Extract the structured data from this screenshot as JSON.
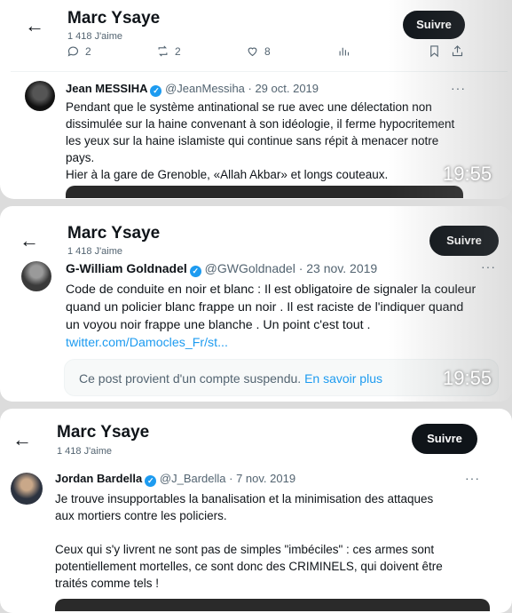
{
  "profile": {
    "name": "Marc Ysaye",
    "likes": "1 418 J'aime",
    "follow_label": "Suivre"
  },
  "actions": {
    "replies": "2",
    "reposts": "2",
    "likes": "8"
  },
  "timestamps": [
    "19:55",
    "19:55"
  ],
  "tweets": [
    {
      "name": "Jean MESSIHA",
      "handle": "@JeanMessiha · 29 oct. 2019",
      "more": "···",
      "lines": [
        "Pendant que le système antinational se rue avec une délectation non",
        "dissimulée sur la haine convenant à son idéologie, il ferme hypocritement",
        "les yeux sur la haine islamiste qui continue sans répit à menacer notre",
        "pays.",
        "Hier à la gare de Grenoble, «Allah Akbar» et longs couteaux."
      ]
    },
    {
      "name": "G-William Goldnadel",
      "handle": "@GWGoldnadel · 23 nov. 2019",
      "more": "···",
      "lines": [
        "Code de conduite en noir et blanc : Il est obligatoire de signaler la couleur",
        "quand un policier blanc  frappe un noir . Il est raciste de l'indiquer quand",
        "un voyou noir frappe une blanche . Un point c'est tout ."
      ],
      "link": "twitter.com/Damocles_Fr/st...",
      "suspended_text": "Ce post provient d'un compte suspendu.",
      "suspended_link": "En savoir plus"
    },
    {
      "name": "Jordan Bardella",
      "handle": "@J_Bardella · 7 nov. 2019",
      "more": "···",
      "lines": [
        "Je trouve insupportables la banalisation et la minimisation des attaques",
        "aux mortiers contre les policiers."
      ],
      "lines2": [
        "Ceux qui s'y livrent ne sont pas de simples \"imbéciles\" : ces armes sont",
        "potentiellement mortelles, ce sont donc des CRIMINELS, qui doivent être",
        "traités comme tels !"
      ]
    }
  ]
}
